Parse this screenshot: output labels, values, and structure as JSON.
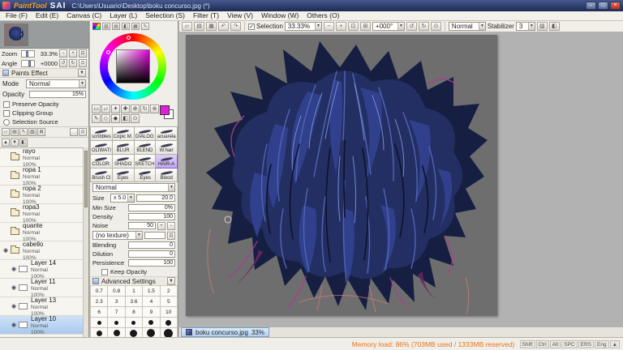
{
  "titlebar": {
    "app_paint": "PaintTool",
    "app_sai": "SAI",
    "path": "C:\\Users\\Usuario\\Desktop\\boku concurso.jpg (*)",
    "min": "–",
    "max": "□",
    "close": "×"
  },
  "menu": [
    "File (F)",
    "Edit (E)",
    "Canvas (C)",
    "Layer (L)",
    "Selection (S)",
    "Filter (T)",
    "View (V)",
    "Window (W)",
    "Others (O)"
  ],
  "toolbar": {
    "selection": "Selection",
    "zoom": "33.33%",
    "angle": "+000°",
    "mode": "Normal",
    "stab_label": "Stabilizer",
    "stab": "3"
  },
  "icons": {
    "new": "▱",
    "open": "▤",
    "save": "▦",
    "undo": "↶",
    "redo": "↷",
    "minus": "−",
    "plus": "+",
    "reset": "⊡",
    "fit": "⊞",
    "ccw": "↺",
    "cw": "↻",
    "dot": "⊙",
    "check": "✓",
    "arrow": "▼",
    "eye": "◉",
    "pen": "✎",
    "marquee": "▭",
    "lasso": "▱",
    "wand": "✦",
    "cross": "✚",
    "zoomtool": "⊕",
    "rotate": "↻",
    "hand": "⊛",
    "diamond": "◇",
    "diamond2": "◆",
    "hatch": "▨",
    "bucket": "◧",
    "up": "▲"
  },
  "navigator": {
    "zoom_label": "Zoom",
    "zoom_value": "33.3%",
    "angle_label": "Angle",
    "angle_value": "+0000"
  },
  "paints": {
    "title": "Paints Effect",
    "mode_label": "Mode",
    "mode": "Normal",
    "opacity_label": "Opacity",
    "opacity": "15%",
    "checks": [
      "Preserve Opacity",
      "Clipping Group",
      "Selection Source"
    ]
  },
  "layers": [
    {
      "name": "rayo",
      "mode": "Normal",
      "opacity": "100%"
    },
    {
      "name": "ropa 1",
      "mode": "Normal",
      "opacity": "100%"
    },
    {
      "name": "ropa 2",
      "mode": "Normal",
      "opacity": "100%"
    },
    {
      "name": "ropa3",
      "mode": "Normal",
      "opacity": "100%"
    },
    {
      "name": "quante",
      "mode": "Normal",
      "opacity": "100%"
    },
    {
      "name": "cabello",
      "mode": "Normal",
      "opacity": "100%"
    },
    {
      "name": "Layer 14",
      "mode": "Normal",
      "opacity": "100%"
    },
    {
      "name": "Layer 11",
      "mode": "Normal",
      "opacity": "100%"
    },
    {
      "name": "Layer 13",
      "mode": "Normal",
      "opacity": "100%"
    },
    {
      "name": "Layer 10",
      "mode": "Normal",
      "opacity": "100%"
    }
  ],
  "brushes": [
    "scribbles",
    "Copic M.",
    "DIALOG",
    "acuarela",
    "OLIWATI",
    "BLUR",
    "BLEND",
    "W.hair",
    "COLOR:",
    "SHADO",
    "SKETCH",
    "HAIR-A",
    "Brush Cl",
    "Eyes",
    ".Eyes",
    "Blood"
  ],
  "settings": {
    "blend": "Normal",
    "size_label": "Size",
    "size_unit": "x 5.0",
    "size": "20.0",
    "min_label": "Min Size",
    "min": "0%",
    "density_label": "Density",
    "density": "100",
    "noise_label": "Noise",
    "noise": "50",
    "texture": "(no texture)",
    "blending_label": "Blending",
    "blending": "0",
    "dilution_label": "Dilution",
    "dilution": "0",
    "persistence_label": "Persistence",
    "persistence": "100",
    "keep": "Keep Opacity",
    "advanced": "Advanced Settings"
  },
  "presets": {
    "row1": [
      "0.7",
      "0.8",
      "1",
      "1.5",
      "2"
    ],
    "row2": [
      "2.3",
      "3",
      "3.6",
      "4",
      "5"
    ],
    "row3": [
      "6",
      "7",
      "8",
      "9",
      "10"
    ],
    "dots1": [
      11,
      13,
      16,
      20,
      25
    ],
    "dots2": [
      30,
      40,
      50,
      60,
      100
    ]
  },
  "doc": {
    "tab": "boku concurso.jpg",
    "zoom": "33%"
  },
  "status": {
    "memory": "Memory load: 86% (703MB used / 1333MB reserved)",
    "keys": [
      "Shift",
      "Ctrl",
      "Alt",
      "SPC",
      "ERS",
      "Eng"
    ]
  },
  "colors": {
    "fg": "#e020d8",
    "canvas_bg": "#6e6e6e",
    "hair_base": "#161f42",
    "memory_text": "#e8741c",
    "selection_accent": "#78a2cc"
  }
}
